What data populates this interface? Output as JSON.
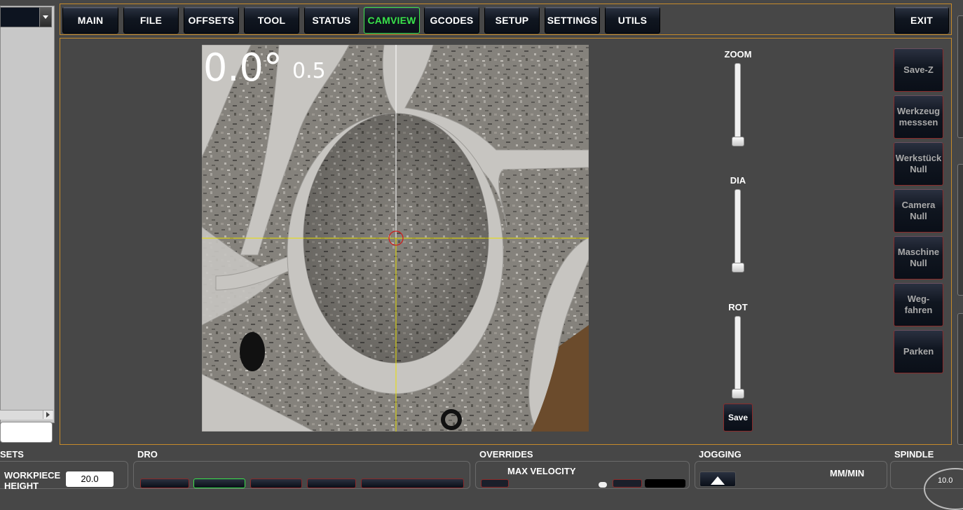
{
  "nav": {
    "tabs": [
      {
        "label": "MAIN"
      },
      {
        "label": "FILE"
      },
      {
        "label": "OFFSETS"
      },
      {
        "label": "TOOL"
      },
      {
        "label": "STATUS"
      },
      {
        "label": "CAMVIEW",
        "active": true
      },
      {
        "label": "GCODES"
      },
      {
        "label": "SETUP"
      },
      {
        "label": "SETTINGS"
      },
      {
        "label": "UTILS"
      }
    ],
    "exit_label": "EXIT"
  },
  "camera": {
    "angle_text": "0.0°",
    "scale_text": "0.5"
  },
  "sliders": {
    "zoom_label": "ZOOM",
    "dia_label": "DIA",
    "rot_label": "ROT",
    "save_label": "Save"
  },
  "actions": [
    {
      "label": "Save-Z"
    },
    {
      "label": "Werkzeug\nmesssen"
    },
    {
      "label": "Werkstück\nNull"
    },
    {
      "label": "Camera\nNull"
    },
    {
      "label": "Maschine\nNull"
    },
    {
      "label": "Weg-\nfahren"
    },
    {
      "label": "Parken"
    }
  ],
  "bottom": {
    "offsets_title": "SETS",
    "workpiece_label": "WORKPIECE\nHEIGHT",
    "workpiece_value": "20.0",
    "dro_title": "DRO",
    "overrides_title": "OVERRIDES",
    "max_velocity_label": "MAX VELOCITY",
    "jogging_title": "JOGGING",
    "jog_units": "MM/MIN",
    "spindle_title": "SPINDLE",
    "spindle_gauge_value": "10.0"
  },
  "colors": {
    "accent_border": "#c78b2a",
    "active_tab": "#39e24a",
    "button_border": "#8b2a2a",
    "crosshair": "#e8e000"
  }
}
